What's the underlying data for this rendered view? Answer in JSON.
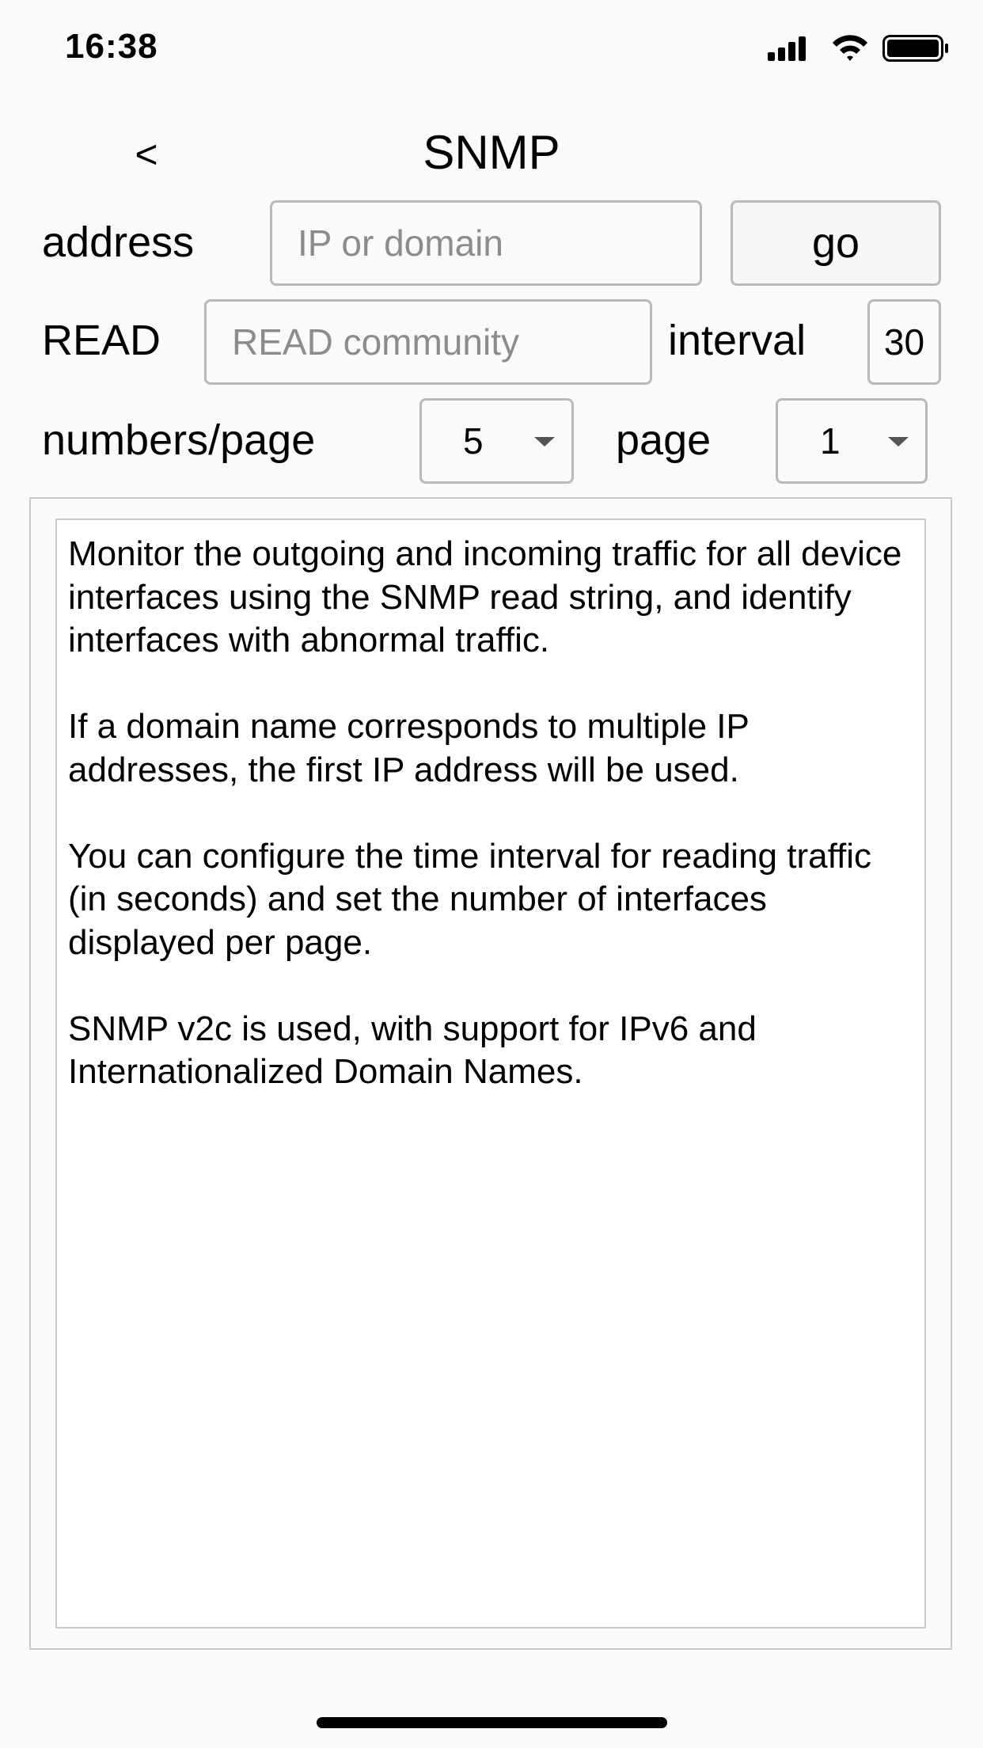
{
  "status_bar": {
    "time": "16:38",
    "icons": [
      "cellular-signal-icon",
      "wifi-icon",
      "battery-icon"
    ]
  },
  "nav": {
    "back_label": "<",
    "title": "SNMP"
  },
  "address_row": {
    "label": "address",
    "placeholder": "IP or domain",
    "value": "",
    "go_label": "go"
  },
  "read_row": {
    "label": "READ",
    "placeholder": "READ community",
    "value": "",
    "interval_label": "interval",
    "interval_value": "30"
  },
  "paging_row": {
    "numbers_label": "numbers/page",
    "numbers_value": "5",
    "page_label": "page",
    "page_value": "1"
  },
  "description": {
    "paragraphs": [
      "Monitor the outgoing and incoming traffic for all device interfaces using the SNMP read string, and identify interfaces with abnormal traffic.",
      "If a domain name corresponds to multiple IP addresses, the first IP address will be used.",
      "You can configure the time interval for reading traffic (in seconds) and set the number of interfaces displayed per page.",
      "SNMP v2c is used, with support for IPv6 and Internationalized Domain Names."
    ]
  }
}
